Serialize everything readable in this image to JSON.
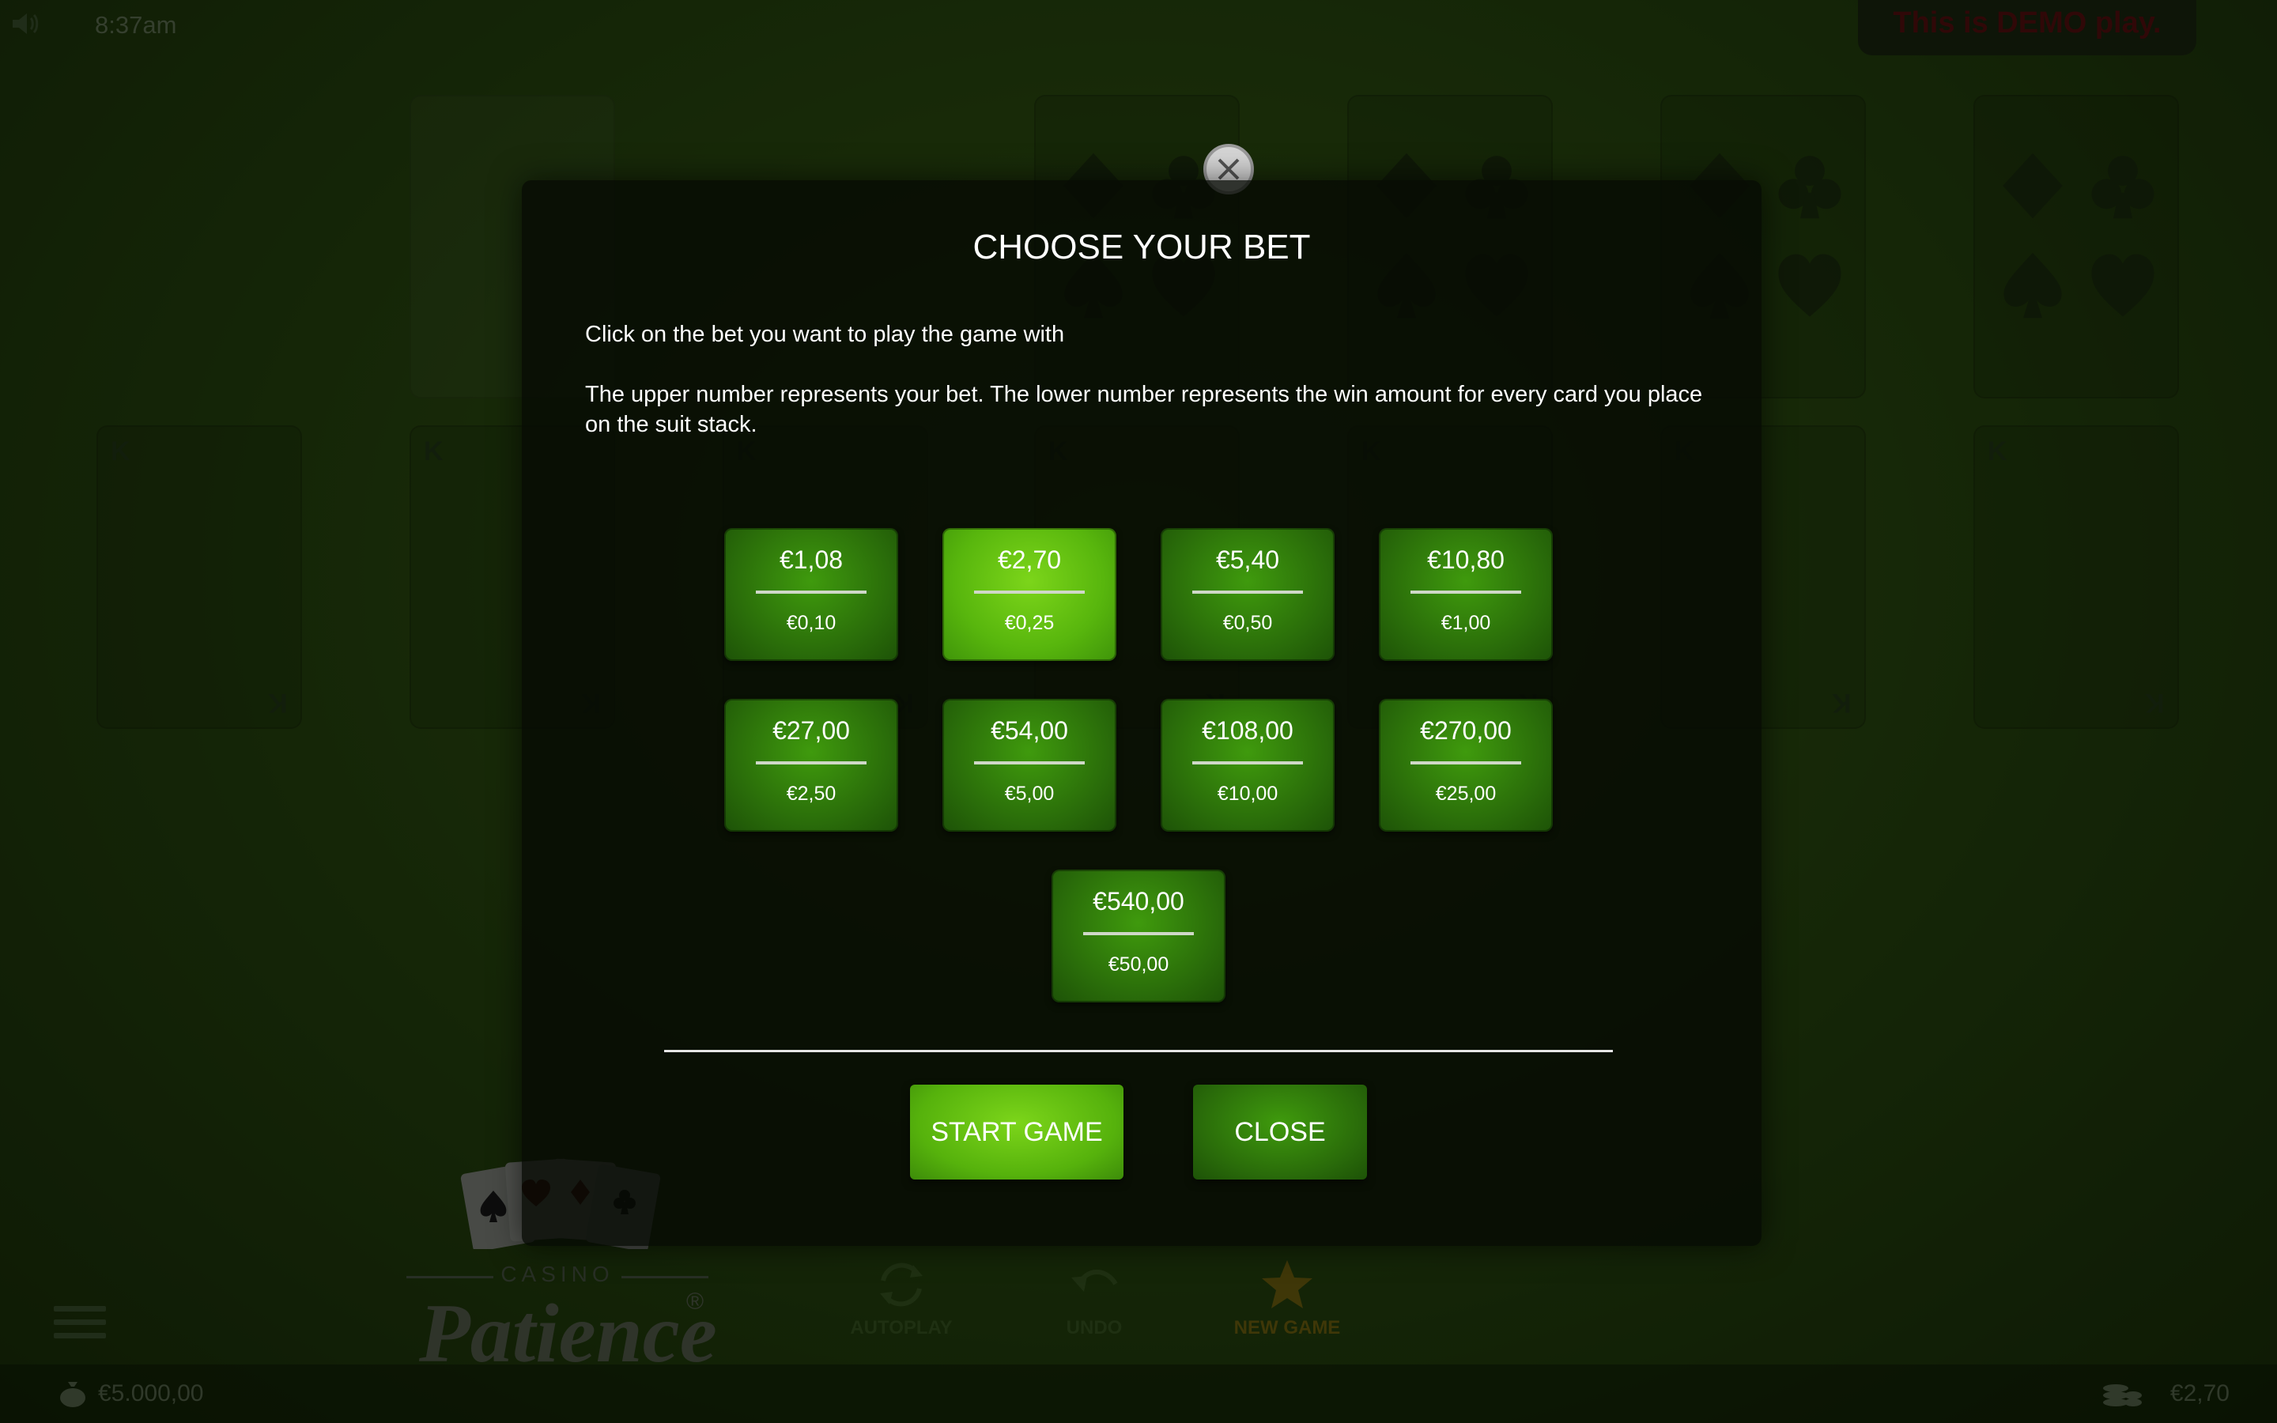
{
  "topbar": {
    "time": "8:37am",
    "demo_label": "This is DEMO play."
  },
  "board": {
    "king_label": "K"
  },
  "logo": {
    "casino": "CASINO",
    "patience": "Patience",
    "reg": "®"
  },
  "controls": {
    "autoplay": "AUTOPLAY",
    "undo": "UNDO",
    "new_game": "NEW GAME"
  },
  "footer": {
    "balance": "€5.000,00",
    "bet": "€2,70"
  },
  "dialog": {
    "title": "CHOOSE YOUR BET",
    "instruction": "Click on the bet you want to play the game with",
    "explanation": "The upper number represents your bet. The lower number represents the win amount for every card you place on the suit stack.",
    "selected_bet": "€2,70",
    "bets": [
      {
        "bet": "€1,08",
        "win": "€0,10"
      },
      {
        "bet": "€2,70",
        "win": "€0,25"
      },
      {
        "bet": "€5,40",
        "win": "€0,50"
      },
      {
        "bet": "€10,80",
        "win": "€1,00"
      },
      {
        "bet": "€27,00",
        "win": "€2,50"
      },
      {
        "bet": "€54,00",
        "win": "€5,00"
      },
      {
        "bet": "€108,00",
        "win": "€10,00"
      },
      {
        "bet": "€270,00",
        "win": "€25,00"
      },
      {
        "bet": "€540,00",
        "win": "€50,00"
      }
    ],
    "start_label": "START GAME",
    "close_label": "CLOSE"
  },
  "colors": {
    "accent": "#58b60d",
    "button_dark": "#2b6f0a",
    "demo_text": "#5c1010"
  }
}
